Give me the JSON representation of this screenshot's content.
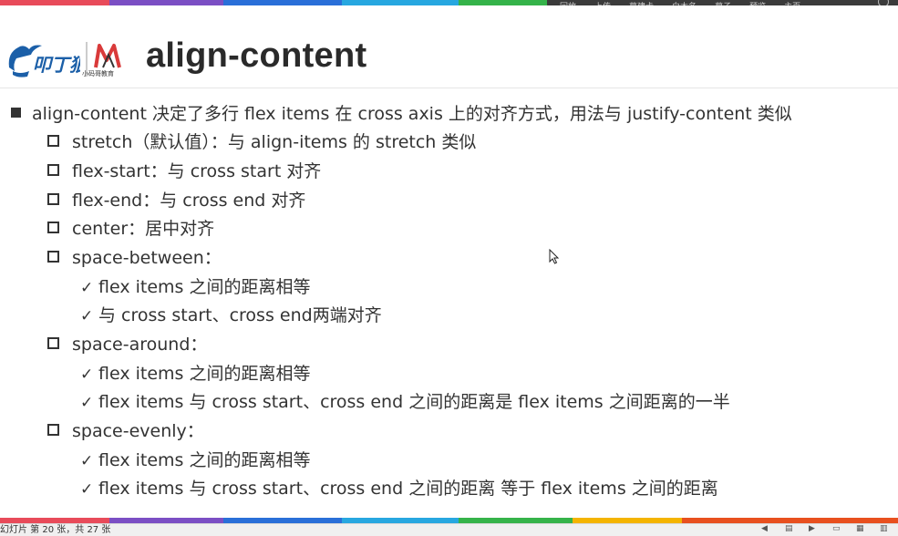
{
  "slide": {
    "title": "align-content",
    "logo_caption": "小码哥教育",
    "lines": [
      {
        "level": 1,
        "text": "align-content 决定了多行 flex items 在 cross axis 上的对齐方式，用法与 justify-content 类似"
      },
      {
        "level": 2,
        "text": "stretch（默认值）：与 align-items 的 stretch 类似"
      },
      {
        "level": 2,
        "text": "flex-start：与 cross start 对齐"
      },
      {
        "level": 2,
        "text": "flex-end：与 cross end 对齐"
      },
      {
        "level": 2,
        "text": "center：居中对齐"
      },
      {
        "level": 2,
        "text": "space-between："
      },
      {
        "level": 3,
        "text": "flex items 之间的距离相等"
      },
      {
        "level": 3,
        "text": "与 cross start、cross end两端对齐"
      },
      {
        "level": 2,
        "text": "space-around："
      },
      {
        "level": 3,
        "text": "flex items 之间的距离相等"
      },
      {
        "level": 3,
        "text": "flex items 与 cross start、cross end 之间的距离是 flex items 之间距离的一半"
      },
      {
        "level": 2,
        "text": "space-evenly："
      },
      {
        "level": 3,
        "text": "flex items 之间的距离相等"
      },
      {
        "level": 3,
        "text": "flex items 与 cross start、cross end 之间的距离 等于 flex items 之间的距离"
      }
    ]
  },
  "overlay": {
    "items": [
      "回放",
      "上传",
      "幕建卡",
      "白木名",
      "幕子",
      "预览",
      "主页"
    ]
  },
  "status": {
    "slide_position": "幻灯片 第 20 张，共 27 张"
  },
  "colors": {
    "stripes": [
      "#e84b5a",
      "#8b4fc4",
      "#2a6fd8",
      "#27a7e0",
      "#35b34a",
      "#f4b400",
      "#e8501f"
    ]
  }
}
